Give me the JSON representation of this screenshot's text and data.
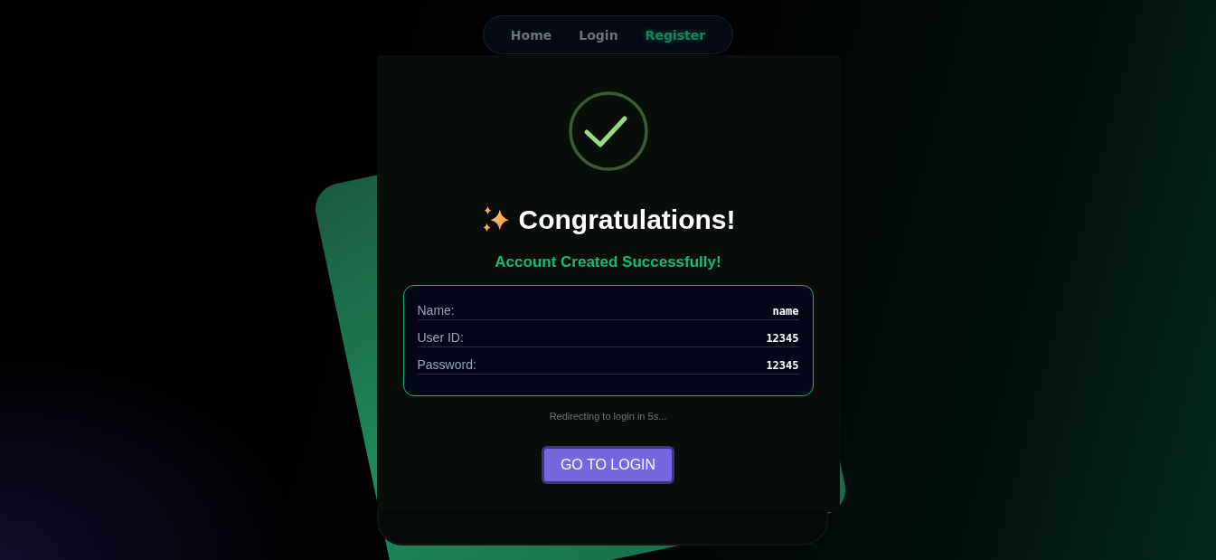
{
  "nav": [
    {
      "label": "Home",
      "selected": false
    },
    {
      "label": "Login",
      "selected": false
    },
    {
      "label": "Register",
      "selected": true
    }
  ],
  "card": {
    "title": "Congratulations!",
    "subtitle": "Account Created Successfully!",
    "details": [
      {
        "label": "Name:",
        "value": "name"
      },
      {
        "label": "User ID:",
        "value": "12345"
      },
      {
        "label": "Password:",
        "value": "12345"
      }
    ],
    "redirect": "Redirecting to login in 5s...",
    "button": "GO TO LOGIN"
  }
}
